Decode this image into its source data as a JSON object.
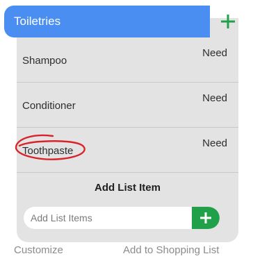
{
  "category": {
    "title": "Toiletries",
    "add_icon": "plus-icon",
    "accent_color": "#4a8ef2",
    "add_color": "#21a04a"
  },
  "items": [
    {
      "name": "Shampoo",
      "status": "Need"
    },
    {
      "name": "Conditioner",
      "status": "Need"
    },
    {
      "name": "Toothpaste",
      "status": "Need",
      "annotated": true,
      "annotation_color": "#d9232b"
    }
  ],
  "add_item": {
    "heading": "Add List Item",
    "placeholder": "Add List Items",
    "value": "",
    "button_icon": "plus-icon"
  },
  "footer": {
    "customize_label": "Customize",
    "add_to_shopping_label": "Add to Shopping List"
  }
}
